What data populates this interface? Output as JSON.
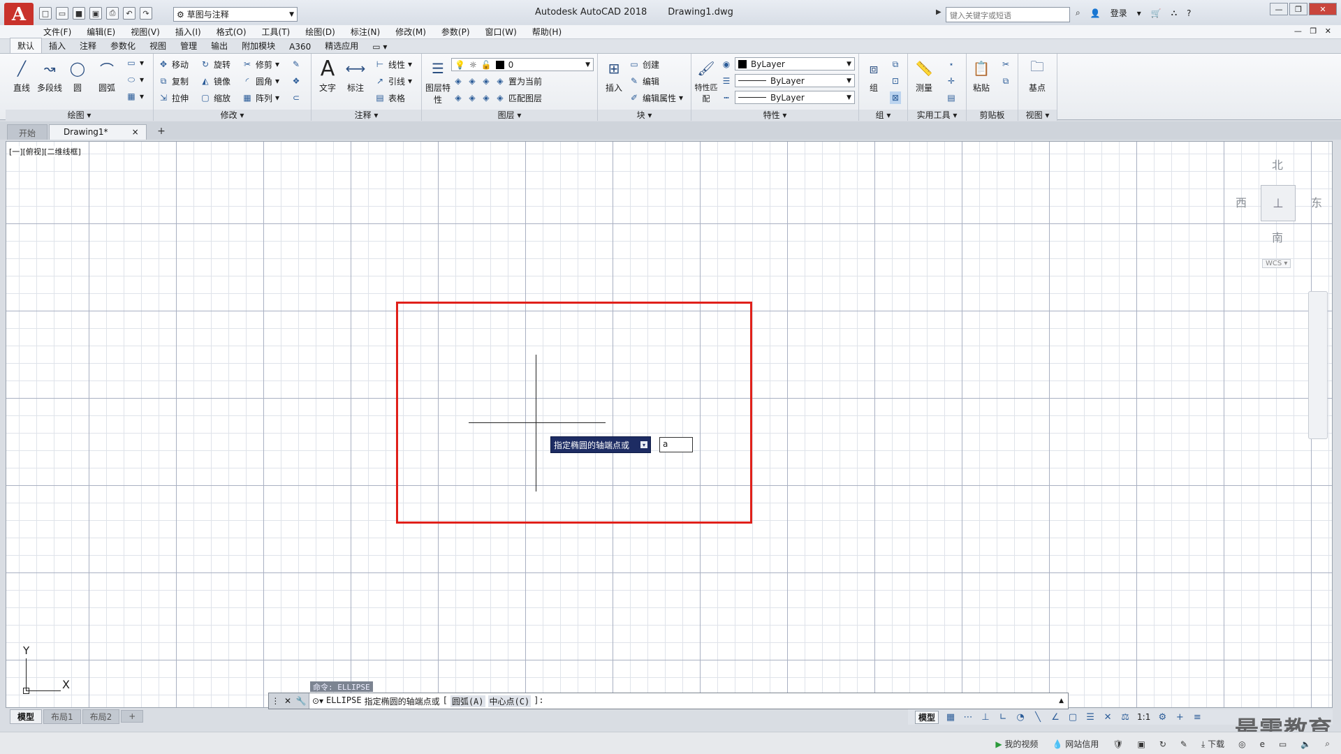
{
  "titlebar": {
    "app_letter": "A",
    "app_name": "Autodesk AutoCAD 2018",
    "doc_name": "Drawing1.dwg",
    "workspace": "草图与注释",
    "search_placeholder": "键入关键字或短语",
    "login": "登录"
  },
  "menu": [
    "文件(F)",
    "编辑(E)",
    "视图(V)",
    "插入(I)",
    "格式(O)",
    "工具(T)",
    "绘图(D)",
    "标注(N)",
    "修改(M)",
    "参数(P)",
    "窗口(W)",
    "帮助(H)"
  ],
  "ribbon_tabs": [
    "默认",
    "插入",
    "注释",
    "参数化",
    "视图",
    "管理",
    "输出",
    "附加模块",
    "A360",
    "精选应用"
  ],
  "ribbon": {
    "draw": {
      "title": "绘图",
      "line": "直线",
      "polyline": "多段线",
      "circle": "圆",
      "arc": "圆弧"
    },
    "modify": {
      "title": "修改",
      "move": "移动",
      "rotate": "旋转",
      "trim": "修剪",
      "copy": "复制",
      "mirror": "镜像",
      "fillet": "圆角",
      "stretch": "拉伸",
      "scale": "缩放",
      "array": "阵列"
    },
    "annotation": {
      "title": "注释",
      "text": "文字",
      "dimension": "标注",
      "linear": "线性",
      "leader": "引线",
      "table": "表格"
    },
    "layers": {
      "title": "图层",
      "layer_props": "图层特性",
      "current_layer": "0",
      "set_current": "置为当前",
      "match_layer": "匹配图层"
    },
    "block": {
      "title": "块",
      "insert": "插入",
      "create": "创建",
      "edit": "编辑",
      "edit_attr": "编辑属性"
    },
    "properties": {
      "title": "特性",
      "match": "特性匹配",
      "color": "ByLayer",
      "lineweight": "ByLayer",
      "linetype": "ByLayer"
    },
    "groups": {
      "title": "组",
      "group": "组"
    },
    "utilities": {
      "title": "实用工具",
      "measure": "测量"
    },
    "clipboard": {
      "title": "剪贴板",
      "paste": "粘贴"
    },
    "view": {
      "title": "视图",
      "base": "基点"
    }
  },
  "file_tabs": {
    "start": "开始",
    "drawing": "Drawing1*"
  },
  "viewport": {
    "label": "[一][俯视][二维线框]",
    "viewcube": {
      "north": "北",
      "south": "南",
      "east": "东",
      "west": "西",
      "wcs": "WCS"
    }
  },
  "dynamic_input": {
    "prompt": "指定椭圆的轴端点或",
    "value": "a"
  },
  "ucs": {
    "x": "X",
    "y": "Y"
  },
  "command": {
    "history": "命令: ELLIPSE",
    "cmd": "ELLIPSE",
    "prompt": "指定椭圆的轴端点或",
    "open_bracket": "[",
    "option_arc": "圆弧(A)",
    "option_center": "中心点(C)",
    "close": "]:"
  },
  "layout_tabs": [
    "模型",
    "布局1",
    "布局2"
  ],
  "status": {
    "model": "模型",
    "scale": "1:1"
  },
  "os_strip": {
    "video": "我的视频",
    "site": "网站信用",
    "download": "下载"
  },
  "watermark": "最需教育",
  "colors": {
    "highlight": "#e0201a",
    "tooltip_bg": "#1d2c63",
    "brand": "#c9322b"
  }
}
